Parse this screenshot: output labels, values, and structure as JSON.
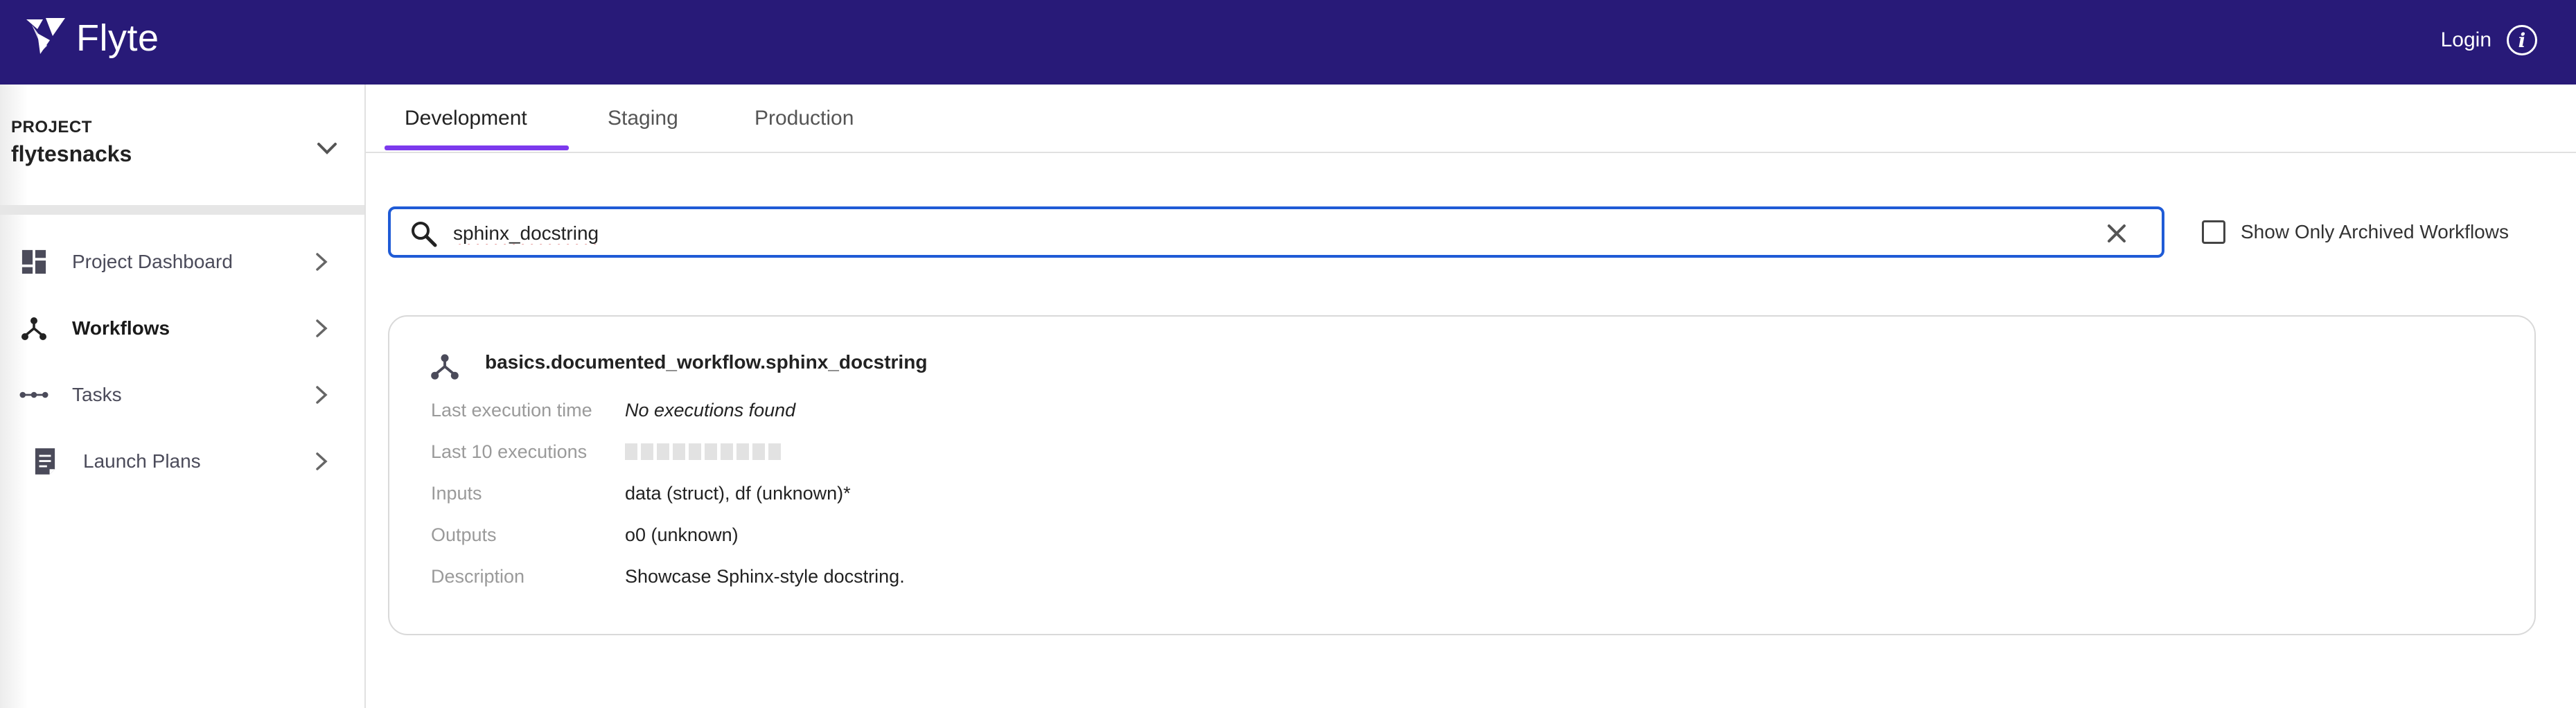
{
  "app": {
    "name": "Flyte"
  },
  "header": {
    "login_label": "Login",
    "brand_color": "#281a78",
    "icons": [
      "flyte-logo-icon",
      "info-icon"
    ]
  },
  "sidebar": {
    "project_label": "PROJECT",
    "project_name": "flytesnacks",
    "items": [
      {
        "label": "Project Dashboard",
        "icon": "dashboard-icon",
        "active": false
      },
      {
        "label": "Workflows",
        "icon": "workflow-icon",
        "active": true
      },
      {
        "label": "Tasks",
        "icon": "tasks-icon",
        "active": false
      },
      {
        "label": "Launch Plans",
        "icon": "launch-plan-icon",
        "active": false
      }
    ]
  },
  "tabs": [
    {
      "label": "Development",
      "active": true
    },
    {
      "label": "Staging",
      "active": false
    },
    {
      "label": "Production",
      "active": false
    }
  ],
  "search": {
    "value": "sphinx_docstring",
    "focus_color": "#1f5bd6"
  },
  "archive_filter": {
    "label": "Show Only Archived Workflows",
    "checked": false
  },
  "workflow": {
    "name": "basics.documented_workflow.sphinx_docstring",
    "fields": {
      "last_execution_time": {
        "key": "Last execution time",
        "value": "No executions found"
      },
      "last_10_executions": {
        "key": "Last 10 executions",
        "count": 10
      },
      "inputs": {
        "key": "Inputs",
        "value": "data (struct), df (unknown)*"
      },
      "outputs": {
        "key": "Outputs",
        "value": "o0 (unknown)"
      },
      "description": {
        "key": "Description",
        "value": "Showcase Sphinx-style docstring."
      }
    }
  },
  "colors": {
    "accent": "#7c3aed",
    "header_bg": "#281a78"
  }
}
